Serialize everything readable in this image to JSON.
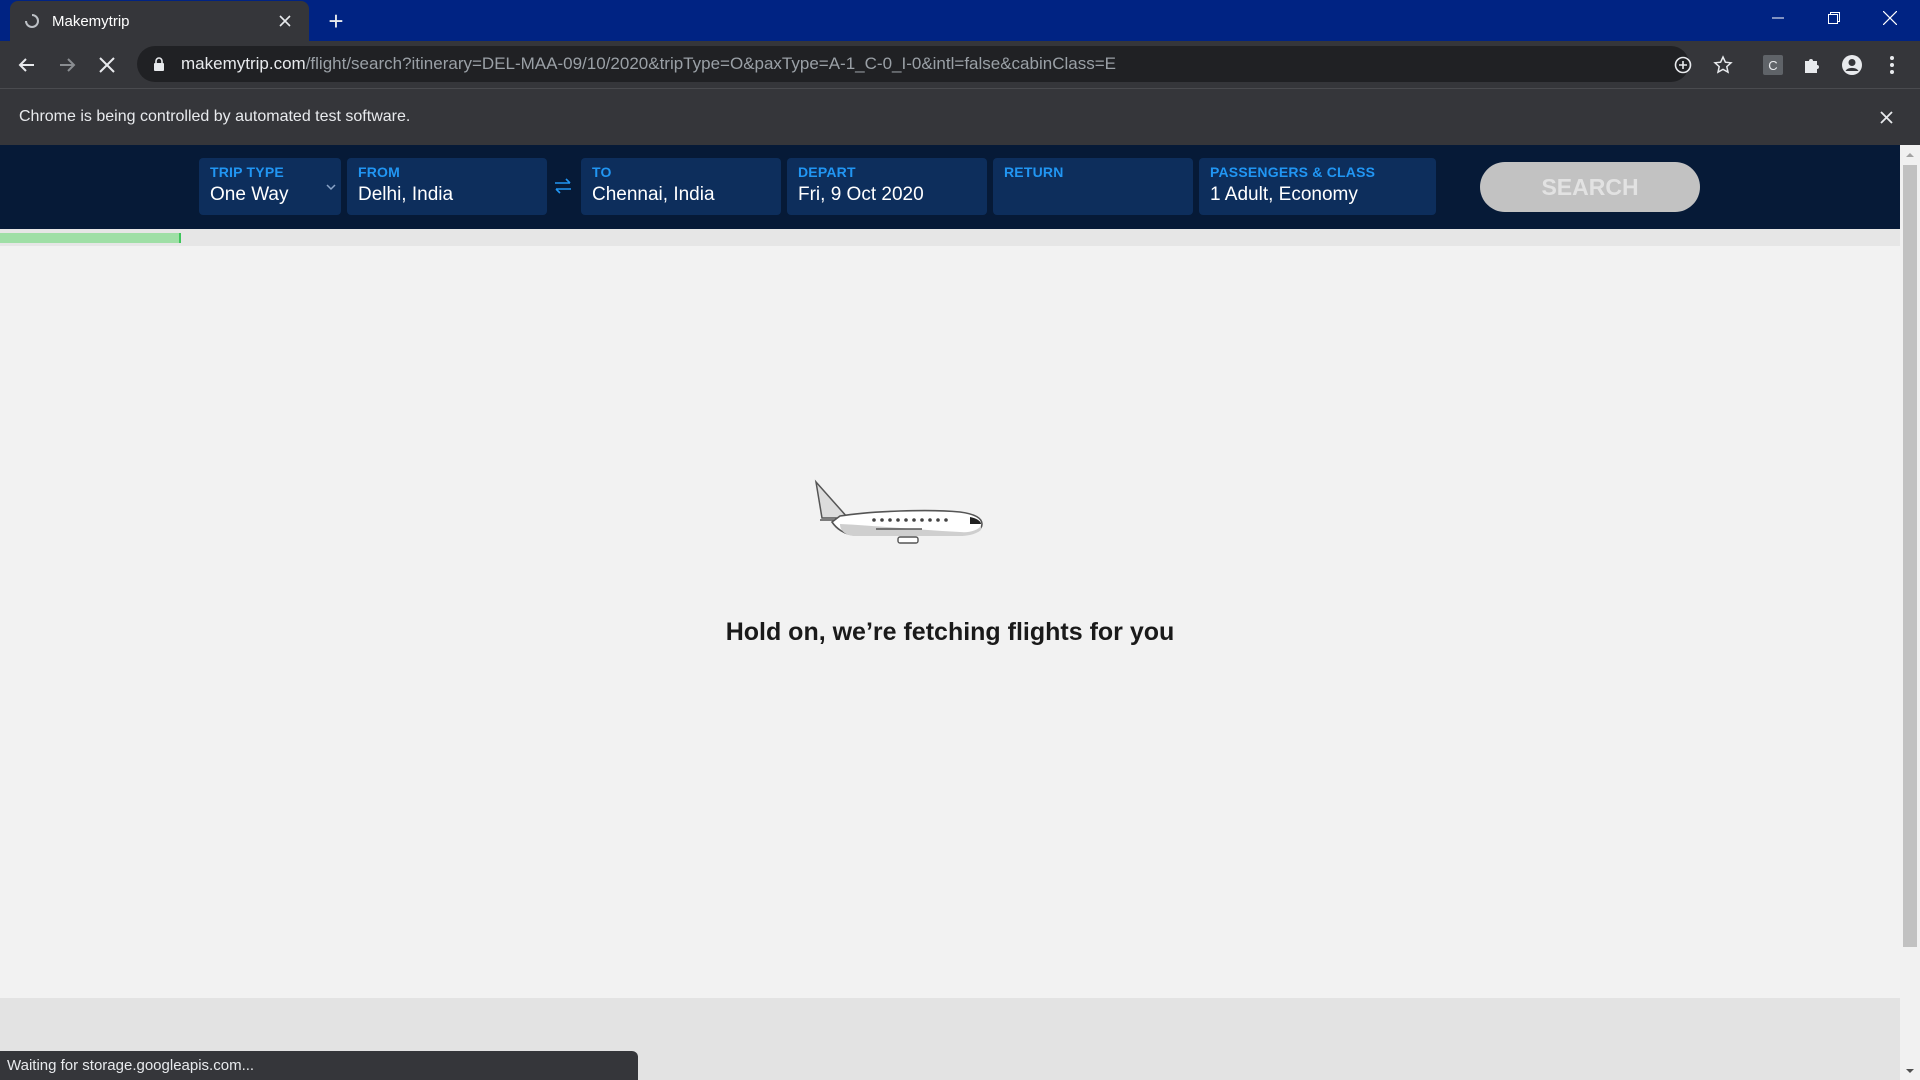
{
  "browser": {
    "tab_title": "Makemytrip",
    "url_host": "makemytrip.com",
    "url_path": "/flight/search?itinerary=DEL-MAA-09/10/2020&tripType=O&paxType=A-1_C-0_I-0&intl=false&cabinClass=E",
    "infobar_text": "Chrome is being controlled by automated test software.",
    "status_text": "Waiting for storage.googleapis.com...",
    "extension_letter": "C",
    "titlebar_color": "#002383"
  },
  "search": {
    "trip_type_label": "TRIP TYPE",
    "trip_type_value": "One Way",
    "from_label": "FROM",
    "from_value": "Delhi, India",
    "to_label": "TO",
    "to_value": "Chennai, India",
    "depart_label": "DEPART",
    "depart_value": "Fri, 9 Oct 2020",
    "return_label": "RETURN",
    "return_value": "",
    "pax_label": "PASSENGERS & CLASS",
    "pax_value": "1 Adult, Economy",
    "search_button": "SEARCH",
    "accent_color": "#2196f3"
  },
  "loading": {
    "message": "Hold on, we’re fetching flights for you",
    "progress_fraction": 0.095
  }
}
